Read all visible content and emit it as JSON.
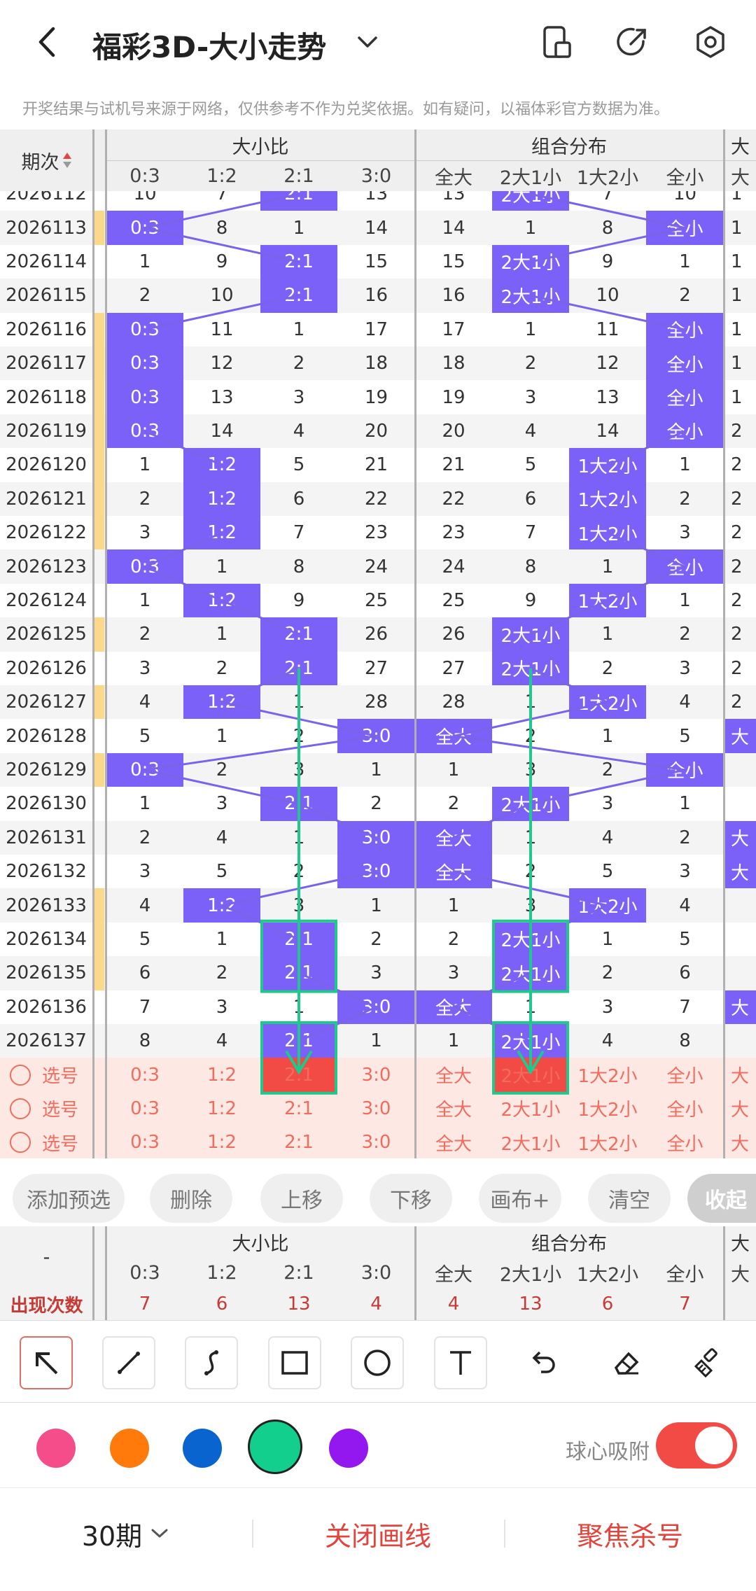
{
  "header": {
    "title": "福彩3D-大小走势",
    "disclaimer": "开奖结果与试机号来源于网络，仅供参考不作为兑奖依据。如有疑问，以福体彩官方数据为准。"
  },
  "chart": {
    "period_label": "期次",
    "group1_label": "大小比",
    "group2_label": "组合分布",
    "group3_label": "大",
    "columns": [
      "0:3",
      "1:2",
      "2:1",
      "3:0",
      "全大",
      "2大1小",
      "1大2小",
      "全小",
      "大"
    ],
    "rows": [
      {
        "period": "2026112",
        "marker": false,
        "cells": [
          "10",
          "7",
          "2:1",
          "13",
          "13",
          "2大1小",
          "7",
          "10",
          "1"
        ],
        "hl": [
          2,
          5
        ]
      },
      {
        "period": "2026113",
        "marker": true,
        "cells": [
          "0:3",
          "8",
          "1",
          "14",
          "14",
          "1",
          "8",
          "全小",
          "1"
        ],
        "hl": [
          0,
          7
        ]
      },
      {
        "period": "2026114",
        "marker": false,
        "cells": [
          "1",
          "9",
          "2:1",
          "15",
          "15",
          "2大1小",
          "9",
          "1",
          "1"
        ],
        "hl": [
          2,
          5
        ]
      },
      {
        "period": "2026115",
        "marker": false,
        "cells": [
          "2",
          "10",
          "2:1",
          "16",
          "16",
          "2大1小",
          "10",
          "2",
          "1"
        ],
        "hl": [
          2,
          5
        ]
      },
      {
        "period": "2026116",
        "marker": true,
        "cells": [
          "0:3",
          "11",
          "1",
          "17",
          "17",
          "1",
          "11",
          "全小",
          "1"
        ],
        "hl": [
          0,
          7
        ]
      },
      {
        "period": "2026117",
        "marker": true,
        "cells": [
          "0:3",
          "12",
          "2",
          "18",
          "18",
          "2",
          "12",
          "全小",
          "1"
        ],
        "hl": [
          0,
          7
        ]
      },
      {
        "period": "2026118",
        "marker": true,
        "cells": [
          "0:3",
          "13",
          "3",
          "19",
          "19",
          "3",
          "13",
          "全小",
          "1"
        ],
        "hl": [
          0,
          7
        ]
      },
      {
        "period": "2026119",
        "marker": true,
        "cells": [
          "0:3",
          "14",
          "4",
          "20",
          "20",
          "4",
          "14",
          "全小",
          "2"
        ],
        "hl": [
          0,
          7
        ]
      },
      {
        "period": "2026120",
        "marker": true,
        "cells": [
          "1",
          "1:2",
          "5",
          "21",
          "21",
          "5",
          "1大2小",
          "1",
          "2"
        ],
        "hl": [
          1,
          6
        ]
      },
      {
        "period": "2026121",
        "marker": true,
        "cells": [
          "2",
          "1:2",
          "6",
          "22",
          "22",
          "6",
          "1大2小",
          "2",
          "2"
        ],
        "hl": [
          1,
          6
        ]
      },
      {
        "period": "2026122",
        "marker": true,
        "cells": [
          "3",
          "1:2",
          "7",
          "23",
          "23",
          "7",
          "1大2小",
          "3",
          "2"
        ],
        "hl": [
          1,
          6
        ]
      },
      {
        "period": "2026123",
        "marker": false,
        "cells": [
          "0:3",
          "1",
          "8",
          "24",
          "24",
          "8",
          "1",
          "全小",
          "2"
        ],
        "hl": [
          0,
          7
        ]
      },
      {
        "period": "2026124",
        "marker": false,
        "cells": [
          "1",
          "1:2",
          "9",
          "25",
          "25",
          "9",
          "1大2小",
          "1",
          "2"
        ],
        "hl": [
          1,
          6
        ]
      },
      {
        "period": "2026125",
        "marker": true,
        "cells": [
          "2",
          "1",
          "2:1",
          "26",
          "26",
          "2大1小",
          "1",
          "2",
          "2"
        ],
        "hl": [
          2,
          5
        ]
      },
      {
        "period": "2026126",
        "marker": false,
        "cells": [
          "3",
          "2",
          "2:1",
          "27",
          "27",
          "2大1小",
          "2",
          "3",
          "2"
        ],
        "hl": [
          2,
          5
        ]
      },
      {
        "period": "2026127",
        "marker": true,
        "cells": [
          "4",
          "1:2",
          "1",
          "28",
          "28",
          "1",
          "1大2小",
          "4",
          "2"
        ],
        "hl": [
          1,
          6
        ]
      },
      {
        "period": "2026128",
        "marker": false,
        "cells": [
          "5",
          "1",
          "2",
          "3:0",
          "全大",
          "2",
          "1",
          "5",
          "大"
        ],
        "hl": [
          3,
          4,
          8
        ]
      },
      {
        "period": "2026129",
        "marker": true,
        "cells": [
          "0:3",
          "2",
          "3",
          "1",
          "1",
          "3",
          "2",
          "全小",
          ""
        ],
        "hl": [
          0,
          7
        ]
      },
      {
        "period": "2026130",
        "marker": false,
        "cells": [
          "1",
          "3",
          "2:1",
          "2",
          "2",
          "2大1小",
          "3",
          "1",
          ""
        ],
        "hl": [
          2,
          5
        ]
      },
      {
        "period": "2026131",
        "marker": false,
        "cells": [
          "2",
          "4",
          "1",
          "3:0",
          "全大",
          "1",
          "4",
          "2",
          "大"
        ],
        "hl": [
          3,
          4,
          8
        ]
      },
      {
        "period": "2026132",
        "marker": false,
        "cells": [
          "3",
          "5",
          "2",
          "3:0",
          "全大",
          "2",
          "5",
          "3",
          "大"
        ],
        "hl": [
          3,
          4,
          8
        ]
      },
      {
        "period": "2026133",
        "marker": true,
        "cells": [
          "4",
          "1:2",
          "3",
          "1",
          "1",
          "3",
          "1大2小",
          "4",
          ""
        ],
        "hl": [
          1,
          6
        ]
      },
      {
        "period": "2026134",
        "marker": true,
        "cells": [
          "5",
          "1",
          "2:1",
          "2",
          "2",
          "2大1小",
          "1",
          "5",
          ""
        ],
        "hl": [
          2,
          5
        ]
      },
      {
        "period": "2026135",
        "marker": true,
        "cells": [
          "6",
          "2",
          "2:1",
          "3",
          "3",
          "2大1小",
          "2",
          "6",
          ""
        ],
        "hl": [
          2,
          5
        ]
      },
      {
        "period": "2026136",
        "marker": false,
        "cells": [
          "7",
          "3",
          "1",
          "3:0",
          "全大",
          "1",
          "3",
          "7",
          "大"
        ],
        "hl": [
          3,
          4,
          8
        ]
      },
      {
        "period": "2026137",
        "marker": false,
        "cells": [
          "8",
          "4",
          "2:1",
          "1",
          "1",
          "2大1小",
          "4",
          "8",
          ""
        ],
        "hl": [
          2,
          5
        ]
      }
    ],
    "pick_rows": [
      {
        "label": "选号",
        "cells": [
          "0:3",
          "1:2",
          "2:1",
          "3:0",
          "全大",
          "2大1小",
          "1大2小",
          "全小",
          "大"
        ],
        "red": [
          2,
          5
        ]
      },
      {
        "label": "选号",
        "cells": [
          "0:3",
          "1:2",
          "2:1",
          "3:0",
          "全大",
          "2大1小",
          "1大2小",
          "全小",
          "大"
        ],
        "red": []
      },
      {
        "label": "选号",
        "cells": [
          "0:3",
          "1:2",
          "2:1",
          "3:0",
          "全大",
          "2大1小",
          "1大2小",
          "全小",
          "大"
        ],
        "red": []
      }
    ]
  },
  "actions": [
    "添加预选",
    "删除",
    "上移",
    "下移",
    "画布+",
    "清空",
    "收起"
  ],
  "stats": {
    "corner": "-",
    "group1_label": "大小比",
    "group2_label": "组合分布",
    "group3_label": "大",
    "row_label": "出现次数",
    "values": [
      "7",
      "6",
      "13",
      "4",
      "4",
      "13",
      "6",
      "7"
    ]
  },
  "tools": [
    "arrow-tool-icon",
    "line-tool-icon",
    "curve-tool-icon",
    "rectangle-tool-icon",
    "circle-tool-icon",
    "text-tool-icon",
    "undo-icon",
    "eraser-icon",
    "brush-clear-icon"
  ],
  "colors": [
    "#f54d8a",
    "#ff7a0a",
    "#0a64d0",
    "#12cf8e",
    "#9317ef"
  ],
  "selected_color": "#12cf8e",
  "snap_label": "球心吸附",
  "snap_on": true,
  "bottom": {
    "period_select": "30期",
    "close_lines": "关闭画线",
    "focus_kill": "聚焦杀号"
  }
}
